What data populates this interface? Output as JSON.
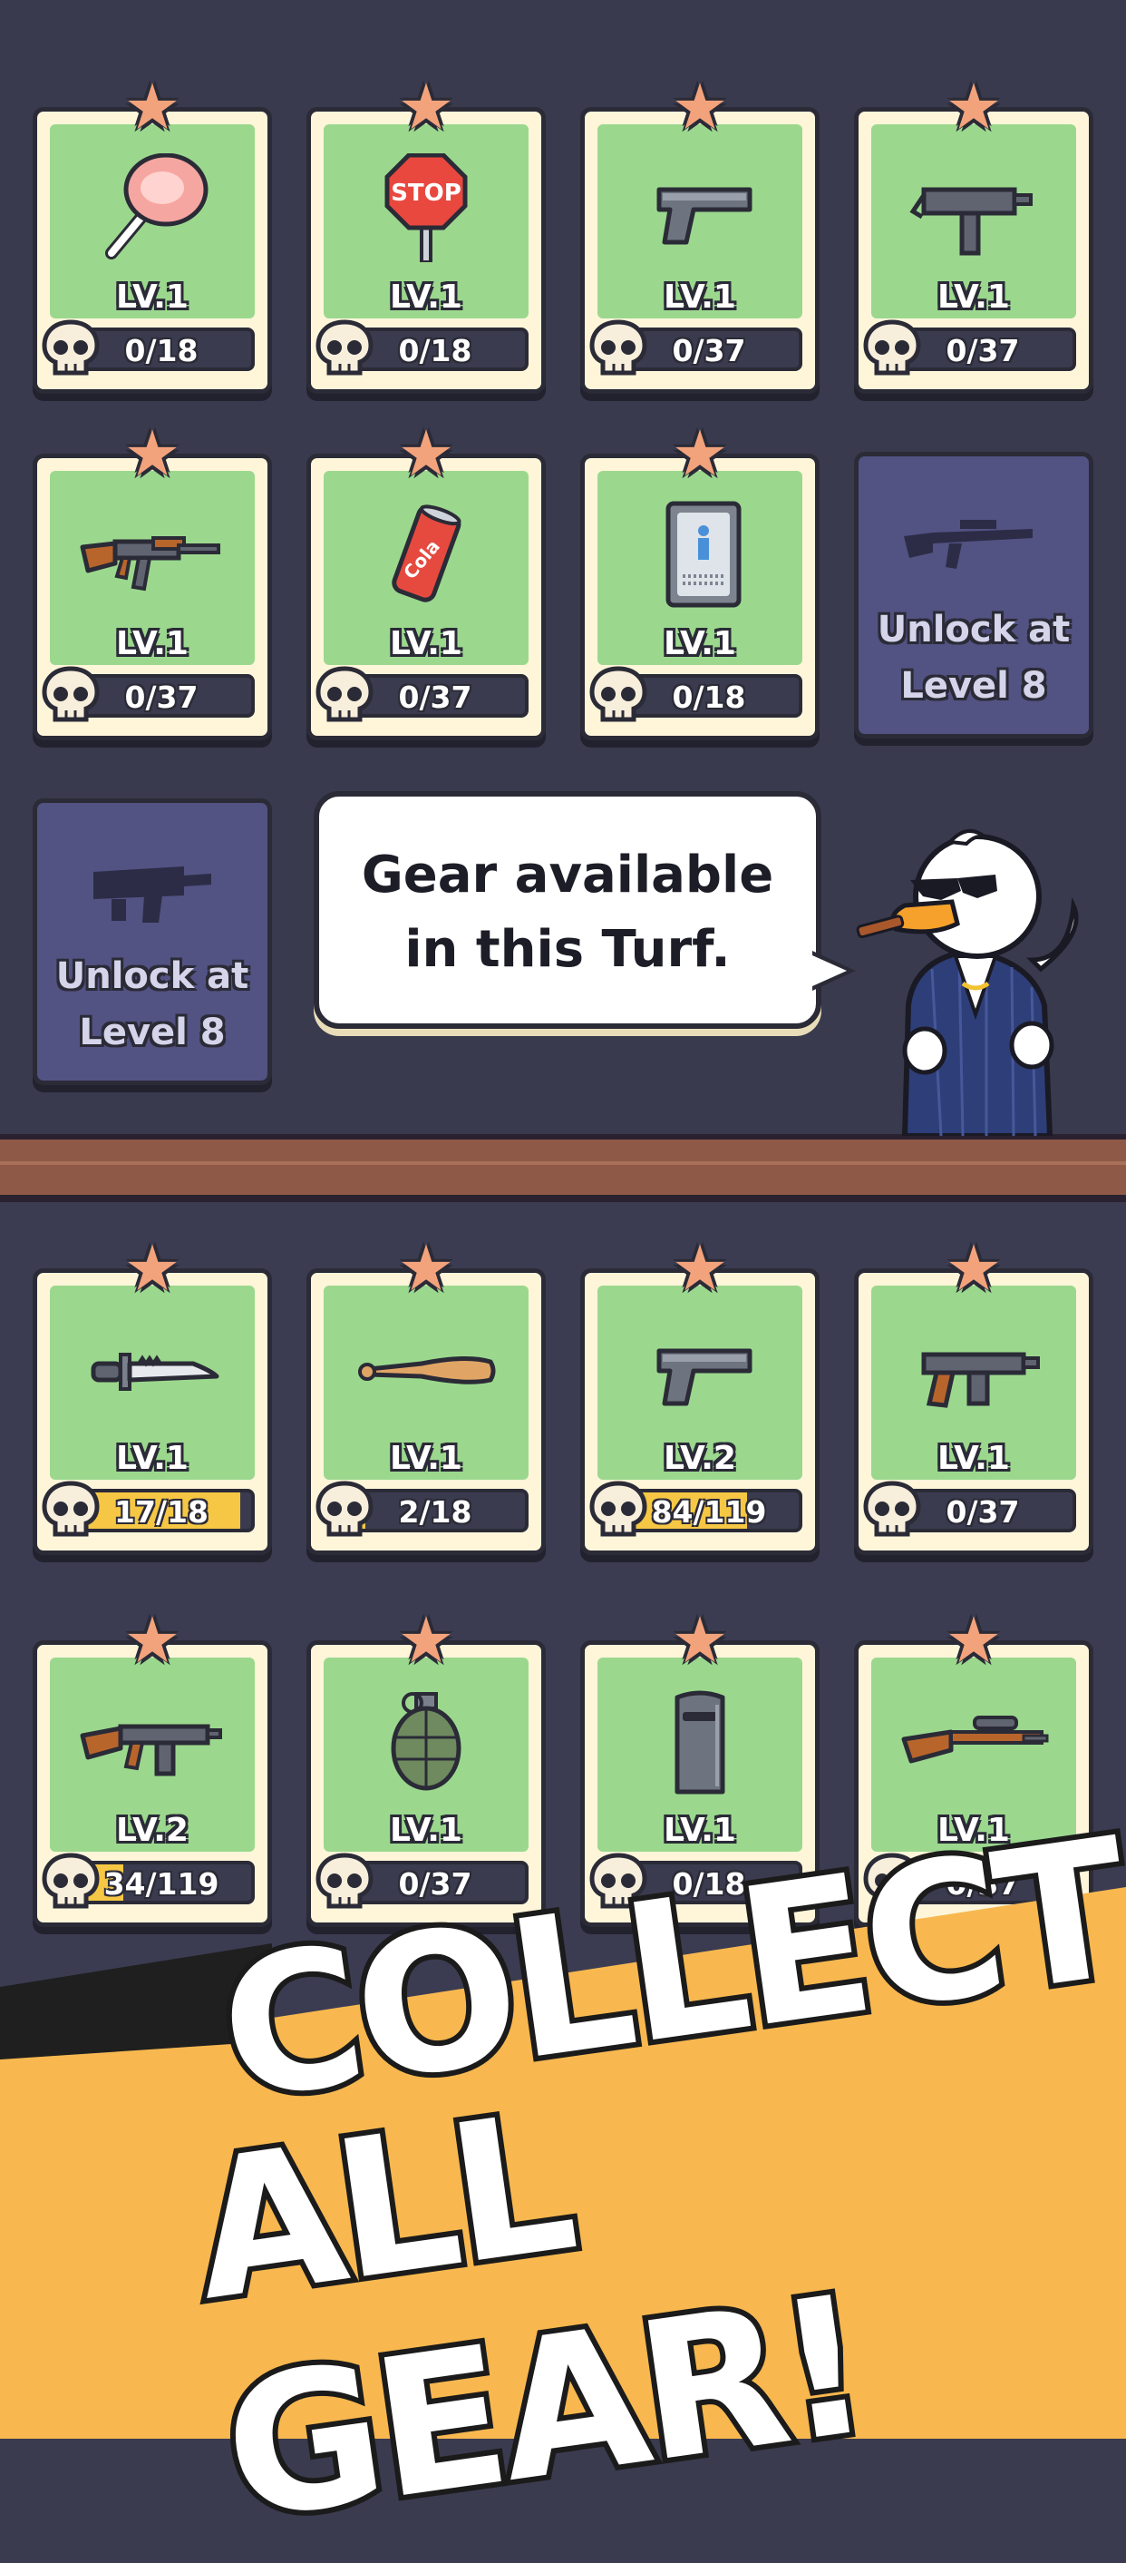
{
  "colors": {
    "background": "#393a4e",
    "card_panel": "#9bd88e",
    "card_frame": "#fff6da",
    "locked_card": "#525283",
    "progress_fill": "#f6c744",
    "banner": "#f8b84f",
    "star": "#f3a37c"
  },
  "turf_gear": [
    {
      "icon": "ham-icon",
      "level": "LV.1",
      "count": "0/18",
      "progress": 0.0
    },
    {
      "icon": "stop-sign-icon",
      "level": "LV.1",
      "count": "0/18",
      "progress": 0.0,
      "sign_text": "STOP"
    },
    {
      "icon": "pistol-icon",
      "level": "LV.1",
      "count": "0/37",
      "progress": 0.0
    },
    {
      "icon": "uzi-icon",
      "level": "LV.1",
      "count": "0/37",
      "progress": 0.0
    },
    {
      "icon": "assault-rifle-icon",
      "level": "LV.1",
      "count": "0/37",
      "progress": 0.0
    },
    {
      "icon": "soda-can-icon",
      "level": "LV.1",
      "count": "0/37",
      "progress": 0.0,
      "can_text": "Cola"
    },
    {
      "icon": "id-card-icon",
      "level": "LV.1",
      "count": "0/18",
      "progress": 0.0
    }
  ],
  "locked_gear": [
    {
      "icon": "sniper-silhouette-icon",
      "text_line1": "Unlock at",
      "text_line2": "Level 8"
    },
    {
      "icon": "heavy-gun-silhouette-icon",
      "text_line1": "Unlock at",
      "text_line2": "Level 8"
    }
  ],
  "speech_bubble": {
    "line1": "Gear available",
    "line2": "in this Turf."
  },
  "collection_gear": [
    {
      "icon": "knife-icon",
      "level": "LV.1",
      "count": "17/18",
      "progress": 0.94
    },
    {
      "icon": "baseball-bat-icon",
      "level": "LV.1",
      "count": "2/18",
      "progress": 0.11
    },
    {
      "icon": "pistol-icon",
      "level": "LV.2",
      "count": "84/119",
      "progress": 0.71
    },
    {
      "icon": "tommy-gun-icon",
      "level": "LV.1",
      "count": "0/37",
      "progress": 0.0
    },
    {
      "icon": "tommy-rifle-icon",
      "level": "LV.2",
      "count": "34/119",
      "progress": 0.29
    },
    {
      "icon": "grenade-icon",
      "level": "LV.1",
      "count": "0/37",
      "progress": 0.0
    },
    {
      "icon": "riot-shield-icon",
      "level": "LV.1",
      "count": "0/18",
      "progress": 0.0
    },
    {
      "icon": "sniper-rifle-icon",
      "level": "LV.1",
      "count": "0/37",
      "progress": 0.0
    }
  ],
  "banner": {
    "line1": "COLLECT",
    "line2": "ALL GEAR!"
  }
}
